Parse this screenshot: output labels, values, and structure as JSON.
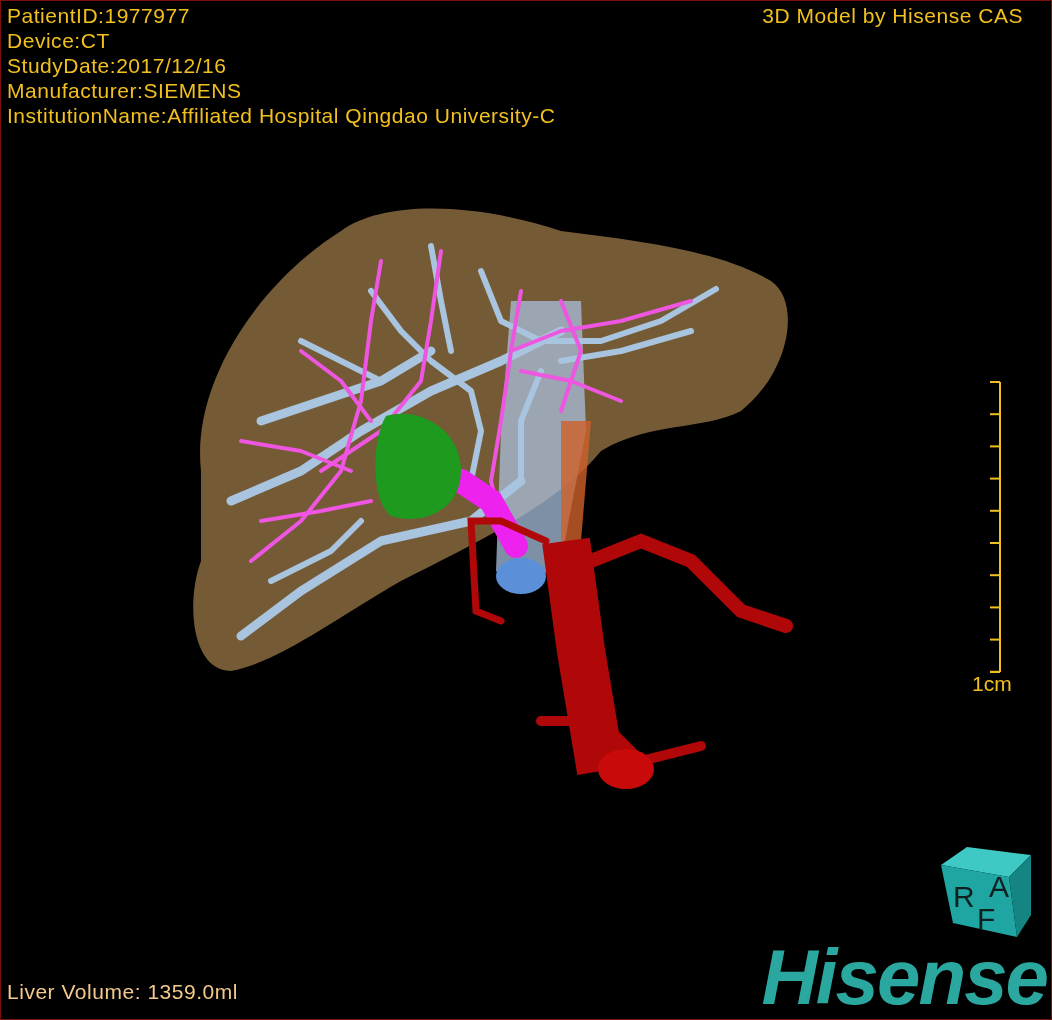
{
  "info_lines": [
    "PatientID:1977977",
    "Device:CT",
    "StudyDate:2017/12/16",
    "Manufacturer:SIEMENS",
    "InstitutionName:Affiliated Hospital Qingdao University-C"
  ],
  "credit": "3D Model by Hisense CAS",
  "scale_bar": {
    "label": "1cm"
  },
  "volume": "Liver Volume: 1359.0ml",
  "orientation_cube": {
    "faces": [
      "R",
      "A",
      "F"
    ]
  },
  "logo": "Hisense"
}
